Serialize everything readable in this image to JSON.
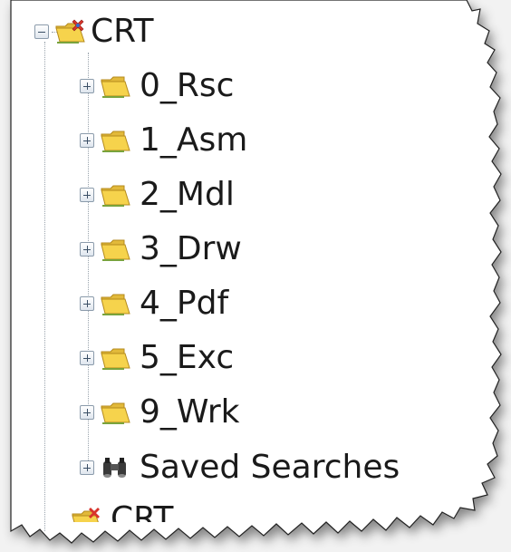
{
  "tree": {
    "root": {
      "label": "CRT",
      "expanded": true,
      "icon": "folder-project-icon"
    },
    "children": [
      {
        "label": "0_Rsc",
        "icon": "folder-icon",
        "expanded": false
      },
      {
        "label": "1_Asm",
        "icon": "folder-icon",
        "expanded": false
      },
      {
        "label": "2_Mdl",
        "icon": "folder-icon",
        "expanded": false
      },
      {
        "label": "3_Drw",
        "icon": "folder-icon",
        "expanded": false
      },
      {
        "label": "4_Pdf",
        "icon": "folder-icon",
        "expanded": false
      },
      {
        "label": "5_Exc",
        "icon": "folder-icon",
        "expanded": false
      },
      {
        "label": "9_Wrk",
        "icon": "folder-icon",
        "expanded": false
      },
      {
        "label": "Saved Searches",
        "icon": "binoculars-icon",
        "expanded": false
      }
    ],
    "next_sibling_label": "CRT"
  },
  "colors": {
    "panel_bg": "#ffffff",
    "folder_fill": "#f6d34c",
    "folder_edge": "#c89b1f",
    "project_badge": "#d8342b",
    "page_bg": "#f2f2f2"
  }
}
